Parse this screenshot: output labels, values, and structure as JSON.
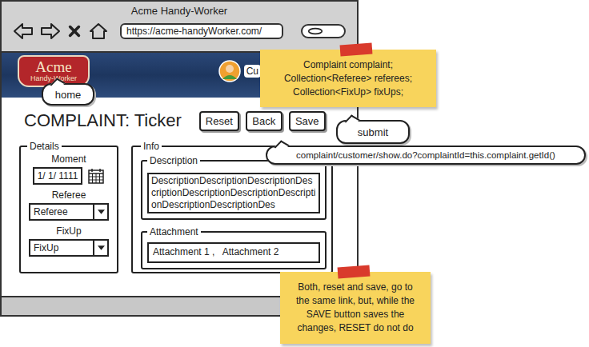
{
  "window": {
    "title": "Acme Handy-Worker"
  },
  "browser": {
    "url": "https://acme-handyWorker.com/"
  },
  "header": {
    "logo": {
      "title": "Acme",
      "subtitle": "Handy-Worker"
    },
    "user": {
      "name": "Cu"
    }
  },
  "page": {
    "title": "COMPLAINT: Ticker",
    "buttons": [
      "Reset",
      "Back",
      "Save"
    ]
  },
  "details": {
    "legend": "Details",
    "fields": [
      {
        "label": "Moment",
        "value": "1/ 1/ 1111",
        "kind": "date"
      },
      {
        "label": "Referee",
        "value": "Referee",
        "kind": "select"
      },
      {
        "label": "FixUp",
        "value": "FixUp",
        "kind": "select"
      }
    ]
  },
  "info": {
    "legend": "Info",
    "description": {
      "legend": "Description",
      "text": "DescriptionDescriptionDescriptionDescriptionDescriptionDescriptionDescriptionDescriptionDescriptionDes"
    },
    "attachment": {
      "legend": "Attachment",
      "text": "Attachment 1 ,   Attachment 2"
    }
  },
  "annotations": {
    "notes": [
      {
        "lines": [
          "Complaint complaint;",
          "Collection<Referee> referees;",
          "Collection<FixUp> fixUps;"
        ]
      },
      {
        "lines": [
          "Both, reset and save, go to",
          "the same link, but, while the",
          "SAVE button saves the",
          "changes, RESET do not do"
        ]
      }
    ],
    "callouts": [
      "home",
      "submit",
      "complaint/customer/show.do?complaintId=this.complaint.getId()"
    ]
  }
}
